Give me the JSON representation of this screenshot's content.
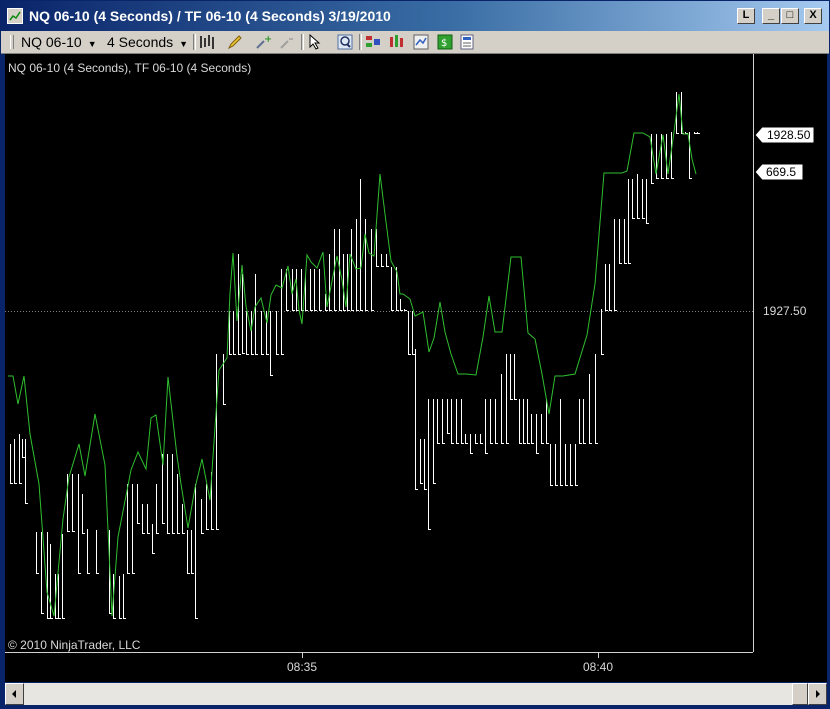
{
  "window": {
    "title": "NQ 06-10 (4 Seconds) / TF 06-10 (4 Seconds)  3/19/2010",
    "buttons": {
      "link": "L",
      "minimize": "_",
      "maximize": "□",
      "close": "X"
    }
  },
  "toolbar": {
    "instrument": "NQ 06-10",
    "interval": "4 Seconds",
    "icons": [
      "bar-type-icon",
      "drawing-pencil-icon",
      "zoom-in-icon",
      "zoom-out-icon",
      "cursor-icon",
      "magnify-icon",
      "indicators-icon",
      "strategies-icon",
      "chart-properties-icon",
      "data-box-icon",
      "properties-icon"
    ]
  },
  "chart": {
    "label": "NQ 06-10 (4 Seconds), TF 06-10 (4 Seconds)",
    "copyright": "© 2010 NinjaTrader, LLC",
    "price_label_top": "1928.50",
    "price_label_green": "669.5",
    "price_label_mid": "1927.50",
    "time_labels": [
      "08:35",
      "08:40"
    ],
    "colors": {
      "background": "#000000",
      "bars": "#ffffff",
      "line": "#2fbf2f",
      "grid": "#808080"
    }
  },
  "chart_data": {
    "type": "line",
    "title": "NQ 06-10 (4 Seconds), TF 06-10 (4 Seconds)",
    "x_ticks": [
      "08:35",
      "08:40"
    ],
    "series": [
      {
        "name": "NQ 06-10 (4 Seconds)",
        "kind": "price-bars",
        "current": 1928.5,
        "reference": 1927.5
      },
      {
        "name": "TF 06-10 (4 Seconds)",
        "kind": "line",
        "current": 669.5
      }
    ]
  }
}
